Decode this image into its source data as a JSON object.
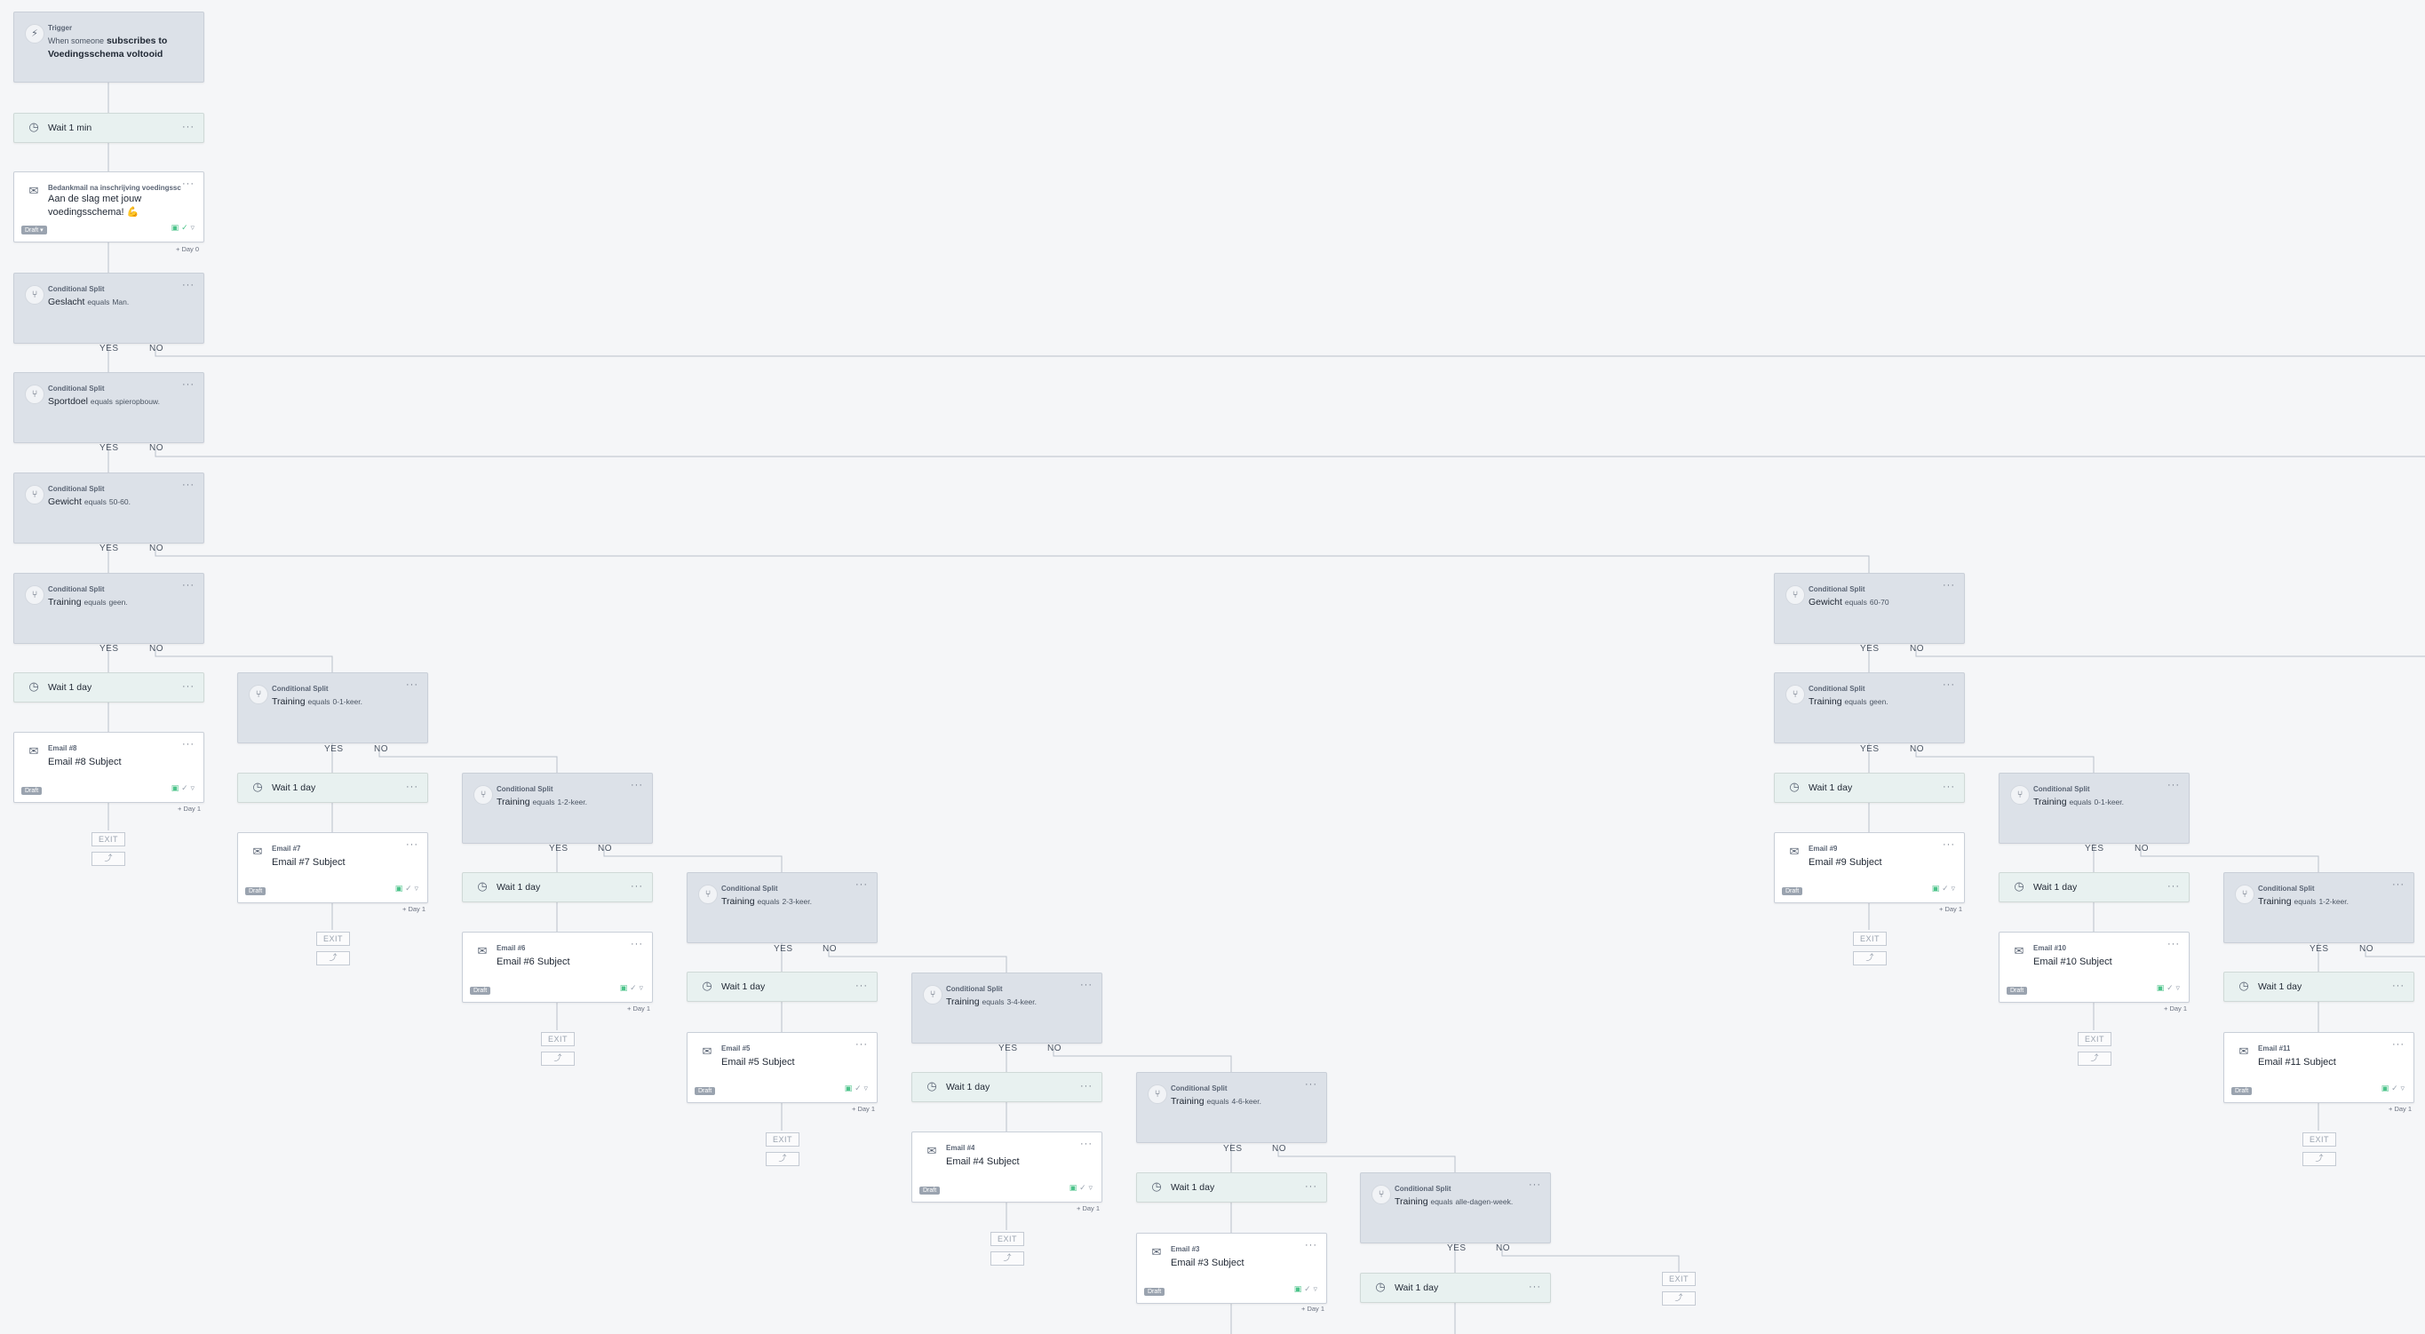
{
  "trigger": {
    "label": "Trigger",
    "text_prefix": "When someone",
    "text_bold": "subscribes to Voedingsschema voltooid"
  },
  "wait_1min": "Wait 1 min",
  "wait_1day": "Wait 1 day",
  "first_email": {
    "name": "Bedankmail na inschrijving voedingsschema",
    "subject": "Aan de slag met jouw voedingsschema! 💪",
    "status": "Draft ▾",
    "day": "Day 0"
  },
  "split_label": "Conditional Split",
  "equals": "equals",
  "yes": "YES",
  "no": "NO",
  "exit": "EXIT",
  "exit_sub": "⤴",
  "draft": "Draft",
  "more": "···",
  "day1": "Day 1",
  "splits": {
    "geslacht": {
      "field": "Geslacht",
      "value": "Man."
    },
    "sportdoel": {
      "field": "Sportdoel",
      "value": "spieropbouw."
    },
    "gewicht5060": {
      "field": "Gewicht",
      "value": "50-60."
    },
    "training_geen": {
      "field": "Training",
      "value": "geen."
    },
    "training_01": {
      "field": "Training",
      "value": "0-1-keer."
    },
    "training_12": {
      "field": "Training",
      "value": "1-2-keer."
    },
    "training_23": {
      "field": "Training",
      "value": "2-3-keer."
    },
    "training_34": {
      "field": "Training",
      "value": "3-4-keer."
    },
    "training_46": {
      "field": "Training",
      "value": "4-6-keer."
    },
    "training_alle": {
      "field": "Training",
      "value": "alle-dagen-week."
    },
    "gewicht6070": {
      "field": "Gewicht",
      "value": "60-70"
    },
    "training_geen_b": {
      "field": "Training",
      "value": "geen."
    },
    "training_01_b": {
      "field": "Training",
      "value": "0-1-keer."
    },
    "training_12_b": {
      "field": "Training",
      "value": "1-2-keer."
    }
  },
  "emails": {
    "e8": {
      "name": "Email #8",
      "subject": "Email #8 Subject"
    },
    "e7": {
      "name": "Email #7",
      "subject": "Email #7 Subject"
    },
    "e6": {
      "name": "Email #6",
      "subject": "Email #6 Subject"
    },
    "e5": {
      "name": "Email #5",
      "subject": "Email #5 Subject"
    },
    "e4": {
      "name": "Email #4",
      "subject": "Email #4 Subject"
    },
    "e3": {
      "name": "Email #3",
      "subject": "Email #3 Subject"
    },
    "e9": {
      "name": "Email #9",
      "subject": "Email #9 Subject"
    },
    "e10": {
      "name": "Email #10",
      "subject": "Email #10 Subject"
    },
    "e11": {
      "name": "Email #11",
      "subject": "Email #11 Subject"
    }
  }
}
